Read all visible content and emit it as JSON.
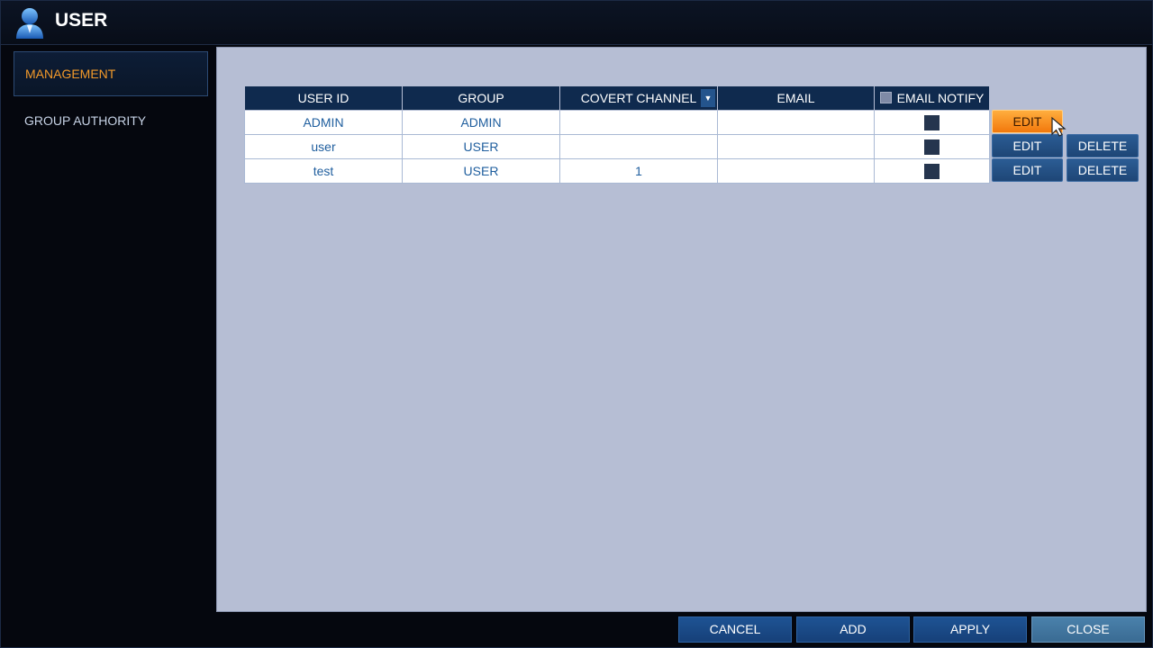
{
  "window": {
    "title": "USER",
    "icon": "user-icon"
  },
  "sidebar": {
    "items": [
      {
        "label": "MANAGEMENT",
        "active": true
      },
      {
        "label": "GROUP AUTHORITY",
        "active": false
      }
    ]
  },
  "table": {
    "headers": {
      "user_id": "USER ID",
      "group": "GROUP",
      "covert_channel": "COVERT CHANNEL",
      "email": "EMAIL",
      "email_notify": "EMAIL NOTIFY"
    },
    "rows": [
      {
        "user_id": "ADMIN",
        "group": "ADMIN",
        "covert_channel": "",
        "email": "",
        "email_notify": false
      },
      {
        "user_id": "user",
        "group": "USER",
        "covert_channel": "",
        "email": "",
        "email_notify": false
      },
      {
        "user_id": "test",
        "group": "USER",
        "covert_channel": "1",
        "email": "",
        "email_notify": false
      }
    ],
    "edit_label": "EDIT",
    "delete_label": "DELETE"
  },
  "footer": {
    "cancel_label": "CANCEL",
    "add_label": "ADD",
    "apply_label": "APPLY",
    "close_label": "CLOSE"
  },
  "colors": {
    "accent_active": "#f39a2a",
    "panel_bg": "#b6bed4",
    "header_bg": "#0f2a4e",
    "button_bg": "#1e4676",
    "button_hover": "#f2780c"
  }
}
